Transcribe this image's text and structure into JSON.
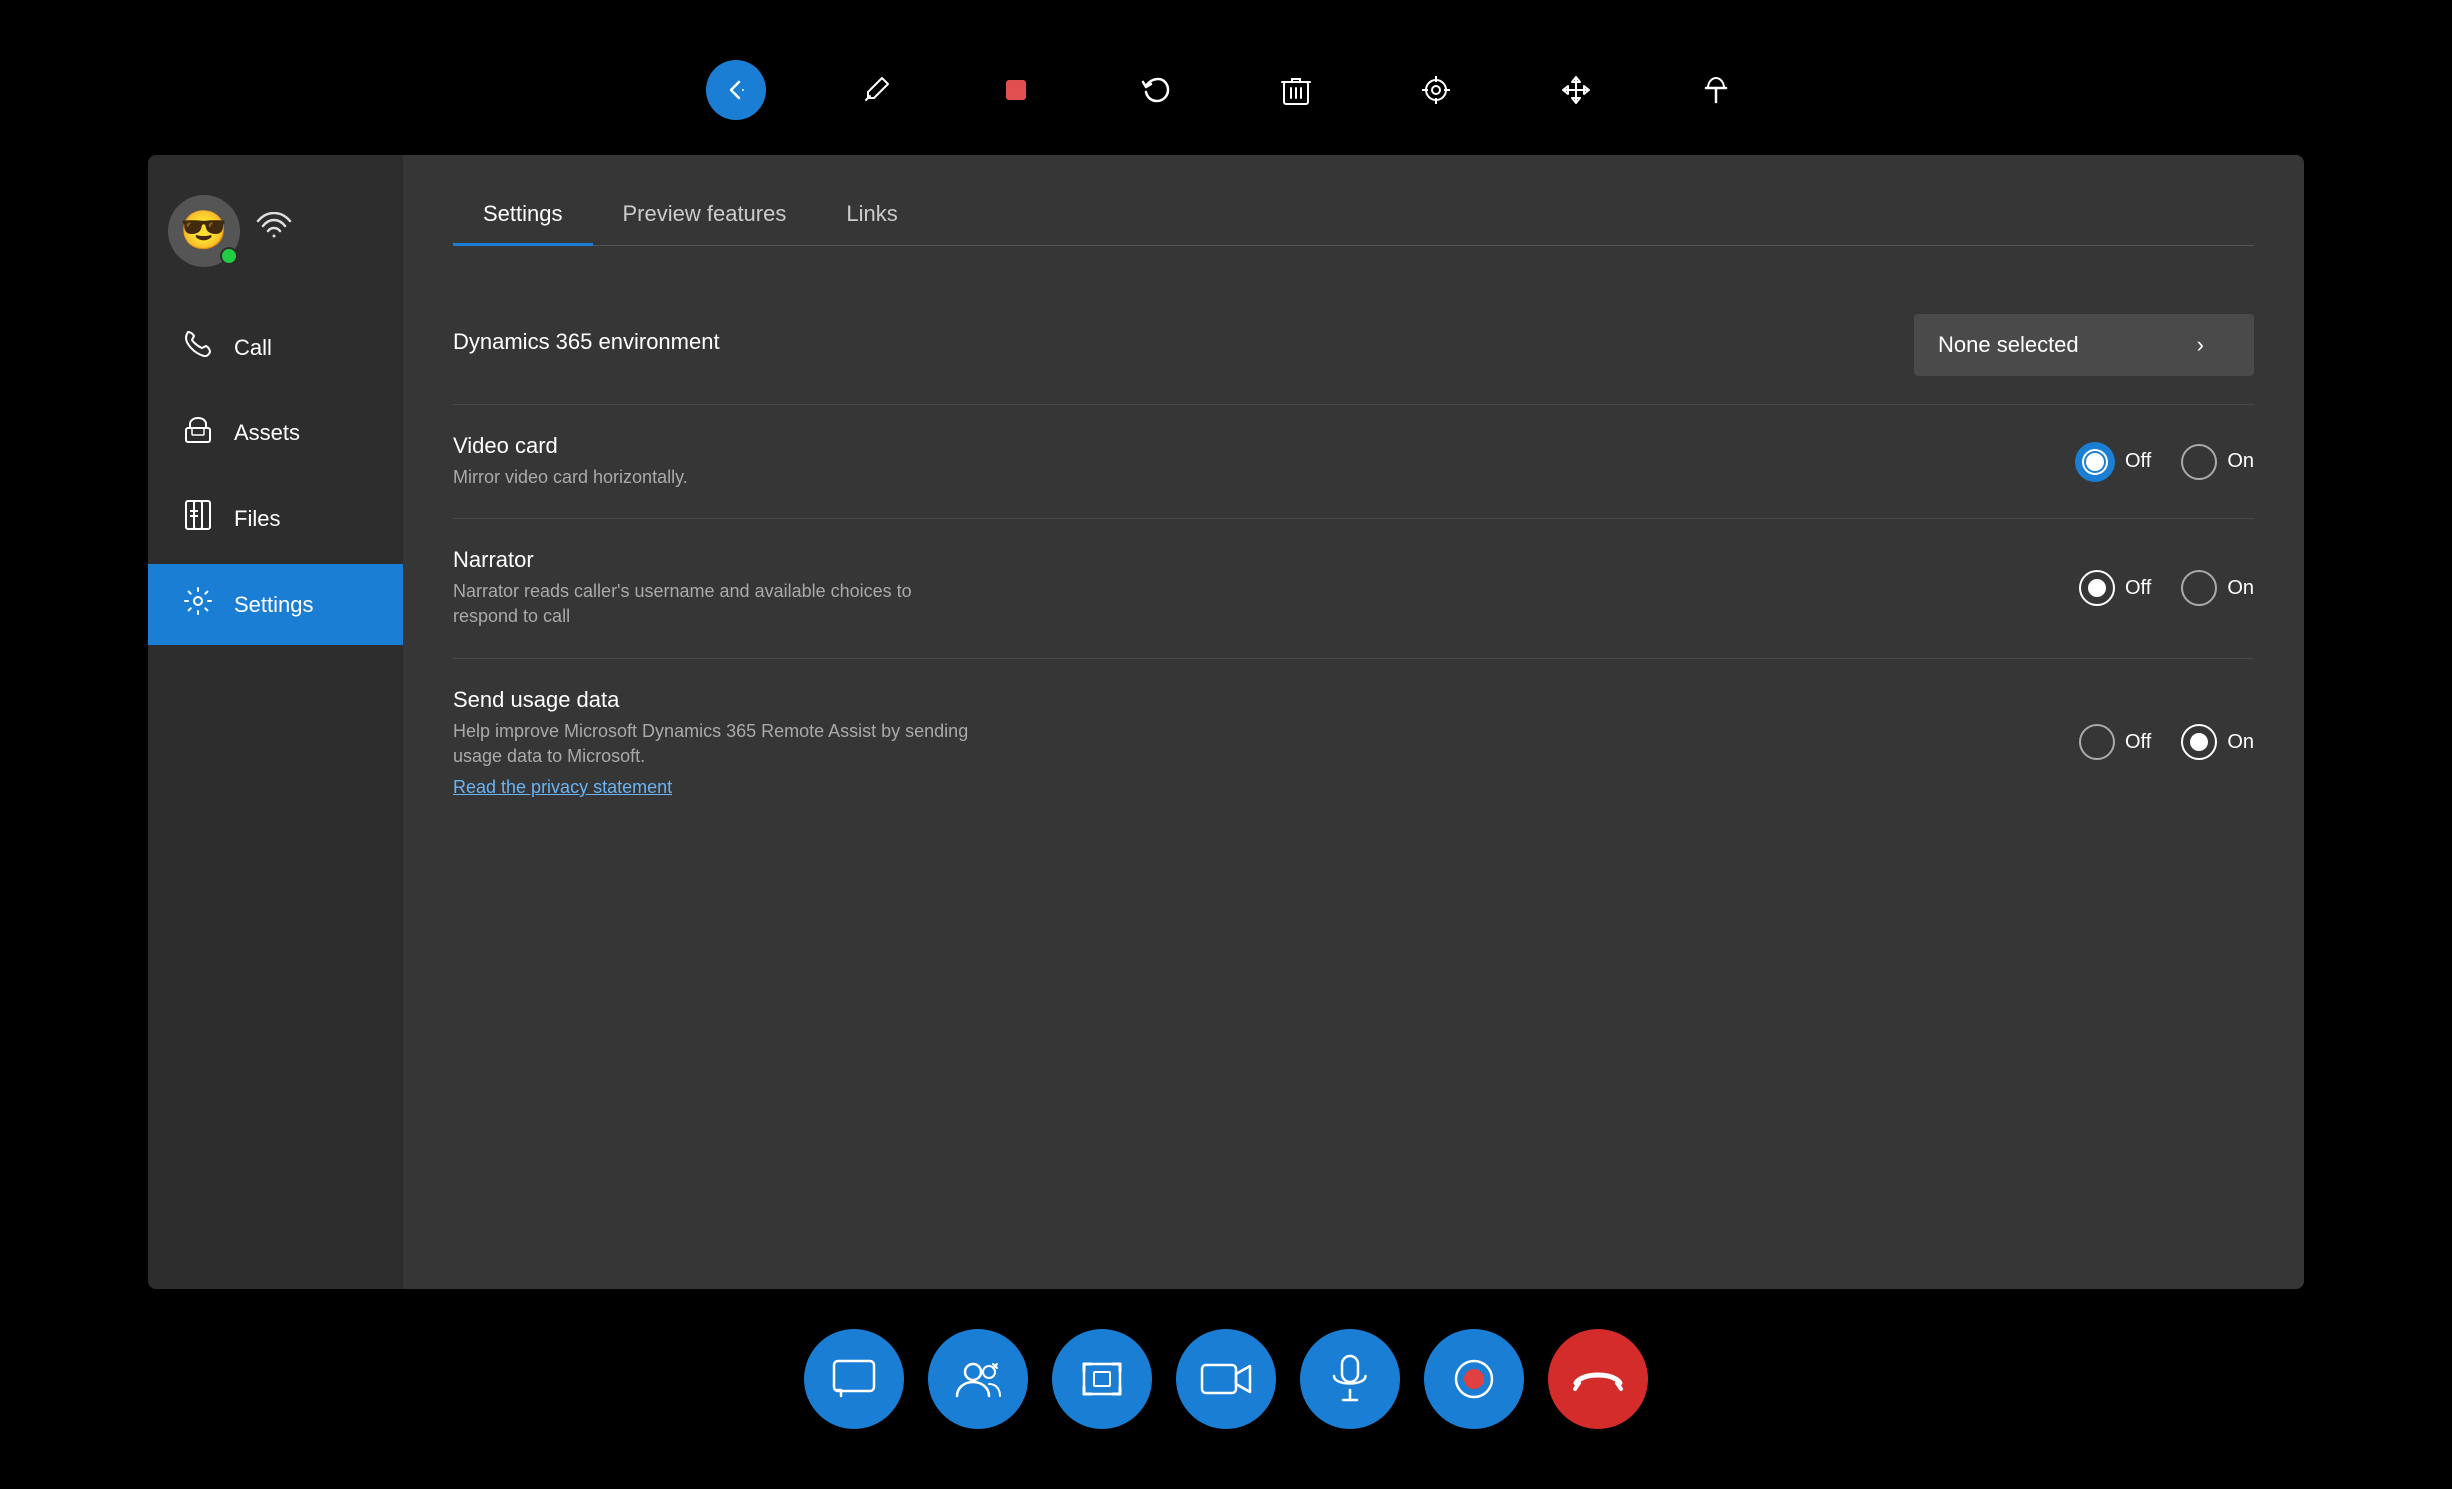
{
  "toolbar": {
    "items": [
      {
        "name": "back-button",
        "icon": "↩",
        "label": "Back",
        "blue": true
      },
      {
        "name": "pen-tool",
        "icon": "✏",
        "label": "Pen"
      },
      {
        "name": "stop-button",
        "icon": "■",
        "label": "Stop",
        "red": true
      },
      {
        "name": "undo-button",
        "icon": "↺",
        "label": "Undo"
      },
      {
        "name": "delete-button",
        "icon": "🗑",
        "label": "Delete"
      },
      {
        "name": "target-button",
        "icon": "◎",
        "label": "Target"
      },
      {
        "name": "move-button",
        "icon": "✥",
        "label": "Move"
      },
      {
        "name": "pin-button",
        "icon": "⊣",
        "label": "Pin"
      }
    ]
  },
  "sidebar": {
    "user": {
      "avatar_emoji": "😎",
      "status": "online"
    },
    "nav_items": [
      {
        "id": "call",
        "label": "Call",
        "icon": "📞"
      },
      {
        "id": "assets",
        "label": "Assets",
        "icon": "📦"
      },
      {
        "id": "files",
        "label": "Files",
        "icon": "📄"
      },
      {
        "id": "settings",
        "label": "Settings",
        "icon": "⚙",
        "active": true
      }
    ]
  },
  "content": {
    "tabs": [
      {
        "id": "settings",
        "label": "Settings",
        "active": true
      },
      {
        "id": "preview",
        "label": "Preview features"
      },
      {
        "id": "links",
        "label": "Links"
      }
    ],
    "settings": {
      "dynamics_env": {
        "title": "Dynamics 365 environment",
        "value": "None selected",
        "dropdown_arrow": "›"
      },
      "video_card": {
        "title": "Video card",
        "desc": "Mirror video card horizontally.",
        "off_selected": true,
        "on_selected": false,
        "off_label": "Off",
        "on_label": "On"
      },
      "narrator": {
        "title": "Narrator",
        "desc": "Narrator reads caller's username and available choices to respond to call",
        "off_selected": true,
        "on_selected": false,
        "off_label": "Off",
        "on_label": "On"
      },
      "send_usage": {
        "title": "Send usage data",
        "desc": "Help improve Microsoft Dynamics 365 Remote Assist by sending usage data to Microsoft.",
        "off_selected": false,
        "on_selected": true,
        "off_label": "Off",
        "on_label": "On",
        "privacy_link": "Read the privacy statement"
      }
    }
  },
  "bottom_toolbar": {
    "buttons": [
      {
        "name": "chat-button",
        "icon": "💬"
      },
      {
        "name": "participants-button",
        "icon": "👥"
      },
      {
        "name": "screenshot-button",
        "icon": "⊞"
      },
      {
        "name": "video-button",
        "icon": "🎥"
      },
      {
        "name": "mic-button",
        "icon": "🎤"
      },
      {
        "name": "record-button",
        "icon": "⏺"
      },
      {
        "name": "end-call-button",
        "icon": "📵",
        "red": true
      }
    ]
  }
}
